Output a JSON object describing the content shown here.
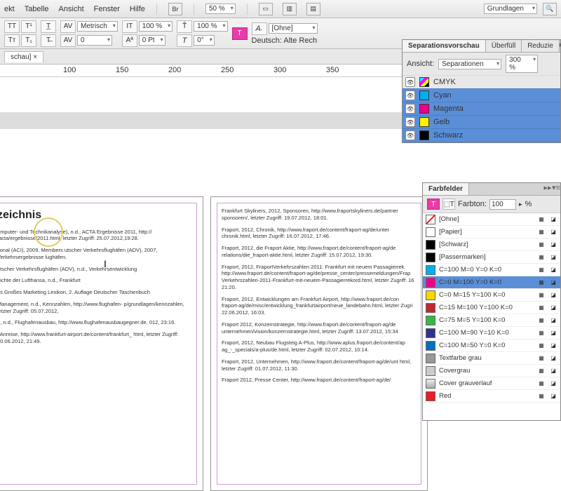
{
  "menu": {
    "items": [
      "ekt",
      "Tabelle",
      "Ansicht",
      "Fenster",
      "Hilfe"
    ],
    "br": "Br",
    "zoom": "50 %",
    "layout": "Grundlagen"
  },
  "toolbar": {
    "metrisch": "Metrisch",
    "pct1": "100 %",
    "pct2": "100 %",
    "pt": "0 Pt",
    "deg": "0°",
    "ohne": "[Ohne]",
    "lang": "Deutsch: Alte Rech"
  },
  "doc": {
    "tab": "schau] ×"
  },
  "ruler": {
    "marks": [
      "100",
      "150",
      "200",
      "250",
      "300",
      "350"
    ]
  },
  "pageLeft": {
    "heading": "zeichnis",
    "paras": [
      "omputer- und Technikanalyse), n.d., ACTA Ergebnisse 2011, http://\n/acta/ergebnisse/2011.html, letzter Zugriff: 25.07.2012,19:28.",
      "tional (ACI), 2009, Members\nutscher Verkehrsflughäfen (ADV), 2007, Verkehrsergebnisse\nlughäfen.",
      "utscher Verkehrsflughäfen (ADV), n.d., Verkehrsentwicklung",
      "hichte der Lufthansa, n.d., Frankfurt",
      "ns Großes Marketing Lexikon, 2. Auflage Deutscher Taschenbuch",
      "Management, n.d., Kennzahlen, http://www.flughafen-\np/grundlagen/kennzahlen, letzter Zugriff: 05.07.2012,",
      "e, n.d., Flughafenausbau, http://www.flughafenausbaugegner.de,\n012, 23:16.",
      ", Anreise, http://www.frankfurt-airport.de/content/frankfurt_\nhtml, letzter Zugriff: 30.06.2012, 21:49."
    ]
  },
  "pageRight": {
    "paras": [
      "Frankfurt Skyliners, 2012, Sponsoren, http://www.fraportskyliners.de/partner\nsponsoren/, letzter Zugriff: 19.07.2012, 18:01.",
      "Fraport, 2012, Chronik, http://www.fraport.de/content/fraport-ag/de/unter\nchronik.html, letzter Zugriff: 16.07.2012, 17:46.",
      "Fraport, 2012, die Fraport Aktie, http://www.fraport.de/content/fraport-ag/de\nrelations/die_fraport-aktie.html, letzter Zugriff: 15.07.2012, 19:30.",
      "Fraport, 2012, FraportVerkehrszahlen 2011: Frankfurt mit neuem Passagierrek\nhttp://www.fraport.de/content/fraport-ag/de/presse_center/pressemeldungen/Frap\nVerkehrszahlen-2011-Frankfurt-mit-neuem-Passagierrekord.html, letzter Zugriff: 16\n21:20.",
      "Fraport, 2012, Entwicklungen am Frankfurt Airport, http://www.fraport.de/con\nfraport-ag/de/misc/entwicklung_frankfurtairport/neue_landebahn.html, letzter Zugri\n22.06.2012, 16:03.",
      "Fraport 2012, Konzernstrategie, http://www.fraport.de/content/fraport-ag/de\nunternehmen/vision/konzernstrategie.html, letzter Zugriff: 13.07.2012, 15:34",
      "Fraport, 2012, Neubau Flugsteig A-Plus, http://www.aplus.fraport.de/content/ap\nag_-_specials/a-plus/de.html, letzter Zugriff: 02.07.2012, 10:14.",
      "Fraport, 2012, Unternehmen, http://www.fraport.de/content/fraport-ag/de/unt\nhtml, letzter Zugriff: 01.07.2012, 11:30.",
      "Fraport 2012, Presse Center, http://www.fraport.de/content/fraport-ag/de/"
    ]
  },
  "sep": {
    "title": "Separationsvorschau",
    "tab2": "Überfüll",
    "tab3": "Reduzie",
    "ansicht": "Ansicht:",
    "mode": "Separationen",
    "zoom": "300 %",
    "items": [
      {
        "name": "CMYK",
        "cls": "cmyk",
        "hdr": true
      },
      {
        "name": "Cyan",
        "cls": "cyan"
      },
      {
        "name": "Magenta",
        "cls": "mag"
      },
      {
        "name": "Gelb",
        "cls": "yel"
      },
      {
        "name": "Schwarz",
        "cls": "blk"
      }
    ]
  },
  "farb": {
    "title": "Farbfelder",
    "farbton": "Farbton:",
    "val": "100",
    "pct": "%",
    "items": [
      {
        "name": "[Ohne]",
        "c": "#fff",
        "none": true
      },
      {
        "name": "[Papier]",
        "c": "#fff"
      },
      {
        "name": "[Schwarz]",
        "c": "#000"
      },
      {
        "name": "[Passermarken]",
        "c": "#000",
        "reg": true
      },
      {
        "name": "C=100 M=0 Y=0 K=0",
        "c": "#00aeef"
      },
      {
        "name": "C=0 M=100 Y=0 K=0",
        "c": "#ec008c",
        "sel": true
      },
      {
        "name": "C=0 M=15 Y=100 K=0",
        "c": "#ffd500"
      },
      {
        "name": "C=15 M=100 Y=100 K=0",
        "c": "#c1272d"
      },
      {
        "name": "C=75 M=5 Y=100 K=0",
        "c": "#39b54a"
      },
      {
        "name": "C=100 M=90 Y=10 K=0",
        "c": "#2e3192"
      },
      {
        "name": "C=100 M=50 Y=0 K=0",
        "c": "#0071bc"
      },
      {
        "name": "Textfarbe grau",
        "c": "#999"
      },
      {
        "name": "Covergrau",
        "c": "#ccc"
      },
      {
        "name": "Cover grauverlauf",
        "c": "#ddd",
        "grad": true
      },
      {
        "name": "Red",
        "c": "#ed1c24"
      }
    ]
  }
}
